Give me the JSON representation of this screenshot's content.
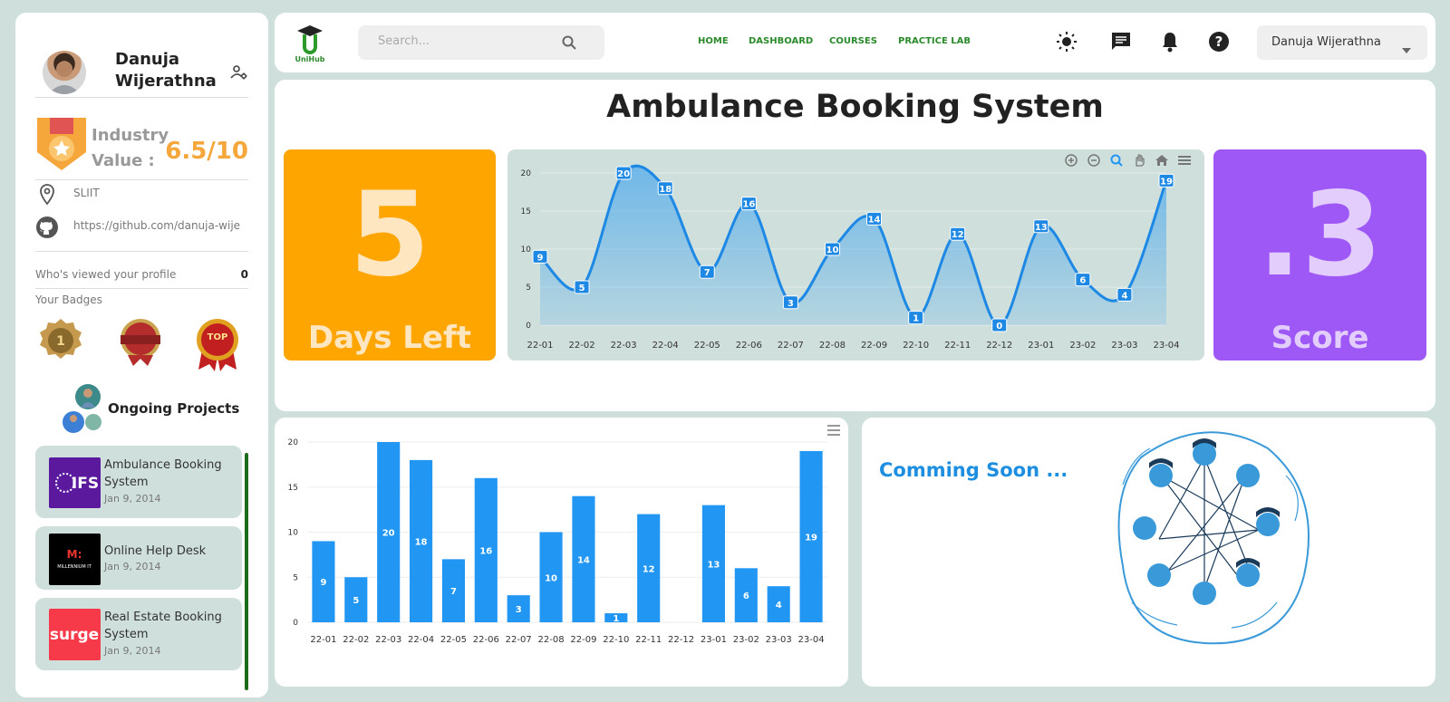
{
  "colors": {
    "accent_green": "#2b8a2b",
    "orange": "#ffa500",
    "purple": "#9e58f5",
    "blue": "#2196f3",
    "value_orange": "#f5a73b"
  },
  "profile": {
    "name": "Danuja Wijerathna",
    "settings_icon": "user-gear-icon"
  },
  "industry": {
    "label": "Industry Value :",
    "value": "6.5/10",
    "icon": "medal-icon"
  },
  "info": {
    "location": "SLIIT",
    "github": "https://github.com/danuja-wije"
  },
  "viewed": {
    "label": "Who's viewed your profile",
    "count": "0"
  },
  "badges": {
    "title": "Your Badges",
    "items": [
      "best-product-badge",
      "excellence-badge",
      "top-service-badge"
    ]
  },
  "ongoing": {
    "title": "Ongoing Projects"
  },
  "projects": [
    {
      "name": "Ambulance Booking System",
      "date": "Jan 9, 2014",
      "logo_text": "IFS",
      "logo_bg": "#5b1a9e"
    },
    {
      "name": "Online Help Desk",
      "date": "Jan 9, 2014",
      "logo_text": "MILLENNIUM IT",
      "logo_bg": "#000000"
    },
    {
      "name": "Real Estate Booking System",
      "date": "Jan 9, 2014",
      "logo_text": "surge",
      "logo_bg": "#f73a4a"
    }
  ],
  "header": {
    "logo_text": "UniHub",
    "search_placeholder": "Search...",
    "nav": [
      "HOME",
      "DASHBOARD",
      "COURSES",
      "PRACTICE LAB"
    ],
    "icons": [
      "brightness-icon",
      "chat-icon",
      "bell-icon",
      "help-icon"
    ],
    "user": "Danuja Wijerathna"
  },
  "main": {
    "title": "Ambulance Booking System",
    "days": {
      "value": "5",
      "label": "Days Left"
    },
    "score": {
      "value": ".3",
      "label": "Score"
    }
  },
  "coming_soon": "Comming Soon ...",
  "chart_data": [
    {
      "type": "area",
      "categories": [
        "22-01",
        "22-02",
        "22-03",
        "22-04",
        "22-05",
        "22-06",
        "22-07",
        "22-08",
        "22-09",
        "22-10",
        "22-11",
        "22-12",
        "23-01",
        "23-02",
        "23-03",
        "23-04"
      ],
      "values": [
        9,
        5,
        20,
        18,
        7,
        16,
        3,
        10,
        14,
        1,
        12,
        0,
        13,
        6,
        4,
        19
      ],
      "yticks": [
        0,
        5,
        10,
        15,
        20
      ],
      "ylim": [
        0,
        20
      ],
      "grid": true
    },
    {
      "type": "bar",
      "categories": [
        "22-01",
        "22-02",
        "22-03",
        "22-04",
        "22-05",
        "22-06",
        "22-07",
        "22-08",
        "22-09",
        "22-10",
        "22-11",
        "22-12",
        "23-01",
        "23-02",
        "23-03",
        "23-04"
      ],
      "values": [
        9,
        5,
        20,
        18,
        7,
        16,
        3,
        10,
        14,
        1,
        12,
        0,
        13,
        6,
        4,
        19
      ],
      "yticks": [
        0,
        5,
        10,
        15,
        20
      ],
      "ylim": [
        0,
        20
      ],
      "grid": true
    }
  ]
}
